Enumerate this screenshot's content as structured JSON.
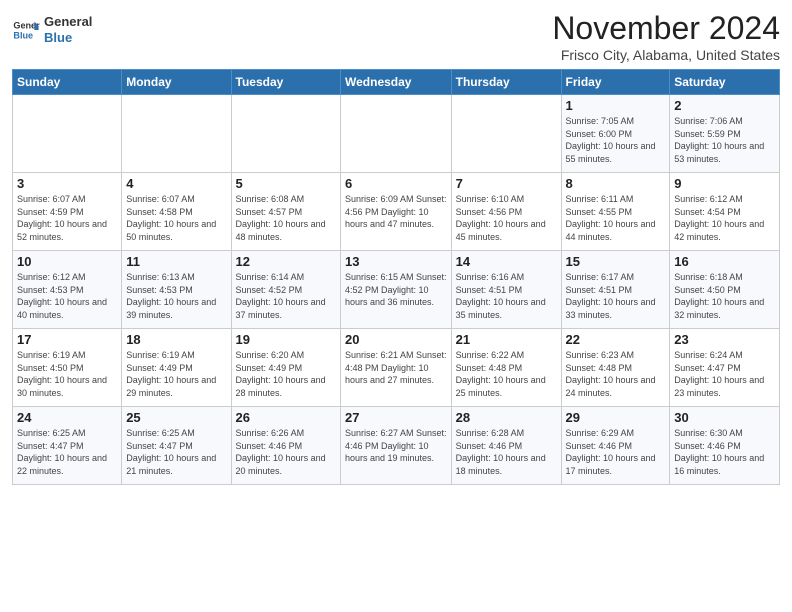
{
  "header": {
    "logo_line1": "General",
    "logo_line2": "Blue",
    "month": "November 2024",
    "location": "Frisco City, Alabama, United States"
  },
  "days_of_week": [
    "Sunday",
    "Monday",
    "Tuesday",
    "Wednesday",
    "Thursday",
    "Friday",
    "Saturday"
  ],
  "weeks": [
    [
      {
        "day": "",
        "info": ""
      },
      {
        "day": "",
        "info": ""
      },
      {
        "day": "",
        "info": ""
      },
      {
        "day": "",
        "info": ""
      },
      {
        "day": "",
        "info": ""
      },
      {
        "day": "1",
        "info": "Sunrise: 7:05 AM\nSunset: 6:00 PM\nDaylight: 10 hours and 55 minutes."
      },
      {
        "day": "2",
        "info": "Sunrise: 7:06 AM\nSunset: 5:59 PM\nDaylight: 10 hours and 53 minutes."
      }
    ],
    [
      {
        "day": "3",
        "info": "Sunrise: 6:07 AM\nSunset: 4:59 PM\nDaylight: 10 hours and 52 minutes."
      },
      {
        "day": "4",
        "info": "Sunrise: 6:07 AM\nSunset: 4:58 PM\nDaylight: 10 hours and 50 minutes."
      },
      {
        "day": "5",
        "info": "Sunrise: 6:08 AM\nSunset: 4:57 PM\nDaylight: 10 hours and 48 minutes."
      },
      {
        "day": "6",
        "info": "Sunrise: 6:09 AM\nSunset: 4:56 PM\nDaylight: 10 hours and 47 minutes."
      },
      {
        "day": "7",
        "info": "Sunrise: 6:10 AM\nSunset: 4:56 PM\nDaylight: 10 hours and 45 minutes."
      },
      {
        "day": "8",
        "info": "Sunrise: 6:11 AM\nSunset: 4:55 PM\nDaylight: 10 hours and 44 minutes."
      },
      {
        "day": "9",
        "info": "Sunrise: 6:12 AM\nSunset: 4:54 PM\nDaylight: 10 hours and 42 minutes."
      }
    ],
    [
      {
        "day": "10",
        "info": "Sunrise: 6:12 AM\nSunset: 4:53 PM\nDaylight: 10 hours and 40 minutes."
      },
      {
        "day": "11",
        "info": "Sunrise: 6:13 AM\nSunset: 4:53 PM\nDaylight: 10 hours and 39 minutes."
      },
      {
        "day": "12",
        "info": "Sunrise: 6:14 AM\nSunset: 4:52 PM\nDaylight: 10 hours and 37 minutes."
      },
      {
        "day": "13",
        "info": "Sunrise: 6:15 AM\nSunset: 4:52 PM\nDaylight: 10 hours and 36 minutes."
      },
      {
        "day": "14",
        "info": "Sunrise: 6:16 AM\nSunset: 4:51 PM\nDaylight: 10 hours and 35 minutes."
      },
      {
        "day": "15",
        "info": "Sunrise: 6:17 AM\nSunset: 4:51 PM\nDaylight: 10 hours and 33 minutes."
      },
      {
        "day": "16",
        "info": "Sunrise: 6:18 AM\nSunset: 4:50 PM\nDaylight: 10 hours and 32 minutes."
      }
    ],
    [
      {
        "day": "17",
        "info": "Sunrise: 6:19 AM\nSunset: 4:50 PM\nDaylight: 10 hours and 30 minutes."
      },
      {
        "day": "18",
        "info": "Sunrise: 6:19 AM\nSunset: 4:49 PM\nDaylight: 10 hours and 29 minutes."
      },
      {
        "day": "19",
        "info": "Sunrise: 6:20 AM\nSunset: 4:49 PM\nDaylight: 10 hours and 28 minutes."
      },
      {
        "day": "20",
        "info": "Sunrise: 6:21 AM\nSunset: 4:48 PM\nDaylight: 10 hours and 27 minutes."
      },
      {
        "day": "21",
        "info": "Sunrise: 6:22 AM\nSunset: 4:48 PM\nDaylight: 10 hours and 25 minutes."
      },
      {
        "day": "22",
        "info": "Sunrise: 6:23 AM\nSunset: 4:48 PM\nDaylight: 10 hours and 24 minutes."
      },
      {
        "day": "23",
        "info": "Sunrise: 6:24 AM\nSunset: 4:47 PM\nDaylight: 10 hours and 23 minutes."
      }
    ],
    [
      {
        "day": "24",
        "info": "Sunrise: 6:25 AM\nSunset: 4:47 PM\nDaylight: 10 hours and 22 minutes."
      },
      {
        "day": "25",
        "info": "Sunrise: 6:25 AM\nSunset: 4:47 PM\nDaylight: 10 hours and 21 minutes."
      },
      {
        "day": "26",
        "info": "Sunrise: 6:26 AM\nSunset: 4:46 PM\nDaylight: 10 hours and 20 minutes."
      },
      {
        "day": "27",
        "info": "Sunrise: 6:27 AM\nSunset: 4:46 PM\nDaylight: 10 hours and 19 minutes."
      },
      {
        "day": "28",
        "info": "Sunrise: 6:28 AM\nSunset: 4:46 PM\nDaylight: 10 hours and 18 minutes."
      },
      {
        "day": "29",
        "info": "Sunrise: 6:29 AM\nSunset: 4:46 PM\nDaylight: 10 hours and 17 minutes."
      },
      {
        "day": "30",
        "info": "Sunrise: 6:30 AM\nSunset: 4:46 PM\nDaylight: 10 hours and 16 minutes."
      }
    ]
  ]
}
